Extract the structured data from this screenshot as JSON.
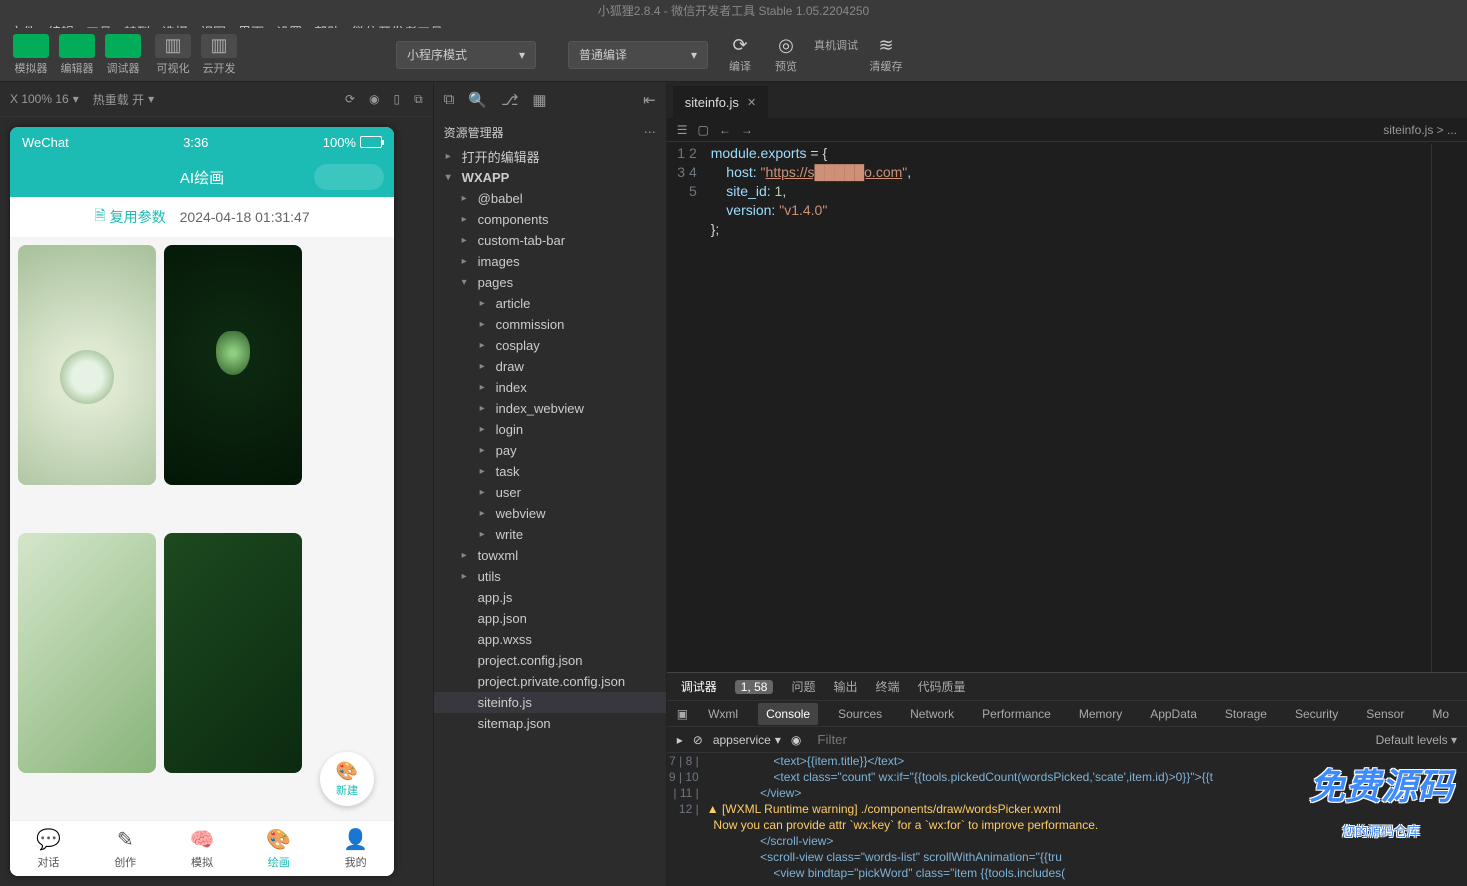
{
  "title": "小狐狸2.8.4 - 微信开发者工具 Stable 1.05.2204250",
  "menu": [
    "文件",
    "编辑",
    "工具",
    "转到",
    "选择",
    "视图",
    "界面",
    "设置",
    "帮助",
    "微信开发者工具"
  ],
  "toolbar": {
    "g1": [
      {
        "l": "模拟器",
        "c": "g"
      },
      {
        "l": "编辑器",
        "c": "g"
      },
      {
        "l": "调试器",
        "c": "g"
      }
    ],
    "g2": [
      {
        "l": "可视化",
        "c": "x"
      },
      {
        "l": "云开发",
        "c": "x"
      }
    ],
    "combo1": "小程序模式",
    "combo2": "普通编译",
    "actions": [
      {
        "l": "编译",
        "i": "⟳"
      },
      {
        "l": "预览",
        "i": "◎"
      },
      {
        "l": "真机调试",
        "i": " "
      },
      {
        "l": "清缓存",
        "i": "≋"
      }
    ]
  },
  "sim": {
    "zoom": "X 100% 16",
    "reload": "热重载 开"
  },
  "phone": {
    "status": {
      "l": "WeChat",
      "c": "3:36",
      "r": "100%"
    },
    "nav": "AI绘画",
    "subL": "复用参数",
    "subR": "2024-04-18 01:31:47",
    "ai": "AI",
    "fab": "新建",
    "tabs": [
      {
        "l": "对话",
        "i": "💬"
      },
      {
        "l": "创作",
        "i": "✎"
      },
      {
        "l": "模拟",
        "i": "🧠"
      },
      {
        "l": "绘画",
        "i": "🎨",
        "a": true
      },
      {
        "l": "我的",
        "i": "👤"
      }
    ]
  },
  "explorer": {
    "header": "资源管理器",
    "s1": "打开的编辑器",
    "s2": "WXAPP",
    "tree": [
      {
        "l": "@babel",
        "i": 1,
        "c": "▸"
      },
      {
        "l": "components",
        "i": 1,
        "c": "▸"
      },
      {
        "l": "custom-tab-bar",
        "i": 1,
        "c": "▸"
      },
      {
        "l": "images",
        "i": 1,
        "c": "▸"
      },
      {
        "l": "pages",
        "i": 1,
        "c": "▾"
      },
      {
        "l": "article",
        "i": 2,
        "c": "▸"
      },
      {
        "l": "commission",
        "i": 2,
        "c": "▸"
      },
      {
        "l": "cosplay",
        "i": 2,
        "c": "▸"
      },
      {
        "l": "draw",
        "i": 2,
        "c": "▸"
      },
      {
        "l": "index",
        "i": 2,
        "c": "▸"
      },
      {
        "l": "index_webview",
        "i": 2,
        "c": "▸"
      },
      {
        "l": "login",
        "i": 2,
        "c": "▸"
      },
      {
        "l": "pay",
        "i": 2,
        "c": "▸"
      },
      {
        "l": "task",
        "i": 2,
        "c": "▸"
      },
      {
        "l": "user",
        "i": 2,
        "c": "▸"
      },
      {
        "l": "webview",
        "i": 2,
        "c": "▸"
      },
      {
        "l": "write",
        "i": 2,
        "c": "▸"
      },
      {
        "l": "towxml",
        "i": 1,
        "c": "▸"
      },
      {
        "l": "utils",
        "i": 1,
        "c": "▸"
      },
      {
        "l": "app.js",
        "i": 1,
        "c": ""
      },
      {
        "l": "app.json",
        "i": 1,
        "c": ""
      },
      {
        "l": "app.wxss",
        "i": 1,
        "c": ""
      },
      {
        "l": "project.config.json",
        "i": 1,
        "c": ""
      },
      {
        "l": "project.private.config.json",
        "i": 1,
        "c": ""
      },
      {
        "l": "siteinfo.js",
        "i": 1,
        "c": "",
        "sel": true
      },
      {
        "l": "sitemap.json",
        "i": 1,
        "c": ""
      }
    ]
  },
  "editor": {
    "tab": "siteinfo.js",
    "crumb": "siteinfo.js > ...",
    "code": {
      "host_key": "host: ",
      "host_val": "https://s█████o.com",
      "siteid_key": "site_id: ",
      "siteid_val": "1",
      "ver_key": "version: ",
      "ver_val": "v1.4.0"
    }
  },
  "dt": {
    "row1": [
      "调试器",
      "1, 58",
      "问题",
      "输出",
      "终端",
      "代码质量"
    ],
    "row2": [
      "Wxml",
      "Console",
      "Sources",
      "Network",
      "Performance",
      "Memory",
      "AppData",
      "Storage",
      "Security",
      "Sensor",
      "Mo"
    ],
    "svc": "appservice",
    "filter_ph": "Filter",
    "levels": "Default levels",
    "lines": [
      {
        "n": "7",
        "t": "                    <text>{{item.title}}</text>"
      },
      {
        "n": "8",
        "t": "                    <text class=\"count\" wx:if=\"{{tools.pickedCount(wordsPicked,'scate',item.id)>0}}\">{{t"
      },
      {
        "n": "9",
        "t": "                </view>"
      },
      {
        "w": true,
        "t": "▲ [WXML Runtime warning] ./components/draw/wordsPicker.wxml"
      },
      {
        "w": true,
        "t": "  Now you can provide attr `wx:key` for a `wx:for` to improve performance."
      },
      {
        "n": "10",
        "t": "                </scroll-view>"
      },
      {
        "n": "11",
        "t": "                <scroll-view class=\"words-list\" scrollWithAnimation=\"{{tru"
      },
      {
        "n": "12",
        "t": "                    <view bindtap=\"pickWord\" class=\"item {{tools.includes("
      }
    ]
  },
  "watermark": {
    "big": "免费源码",
    "small": "您的源码仓库"
  }
}
